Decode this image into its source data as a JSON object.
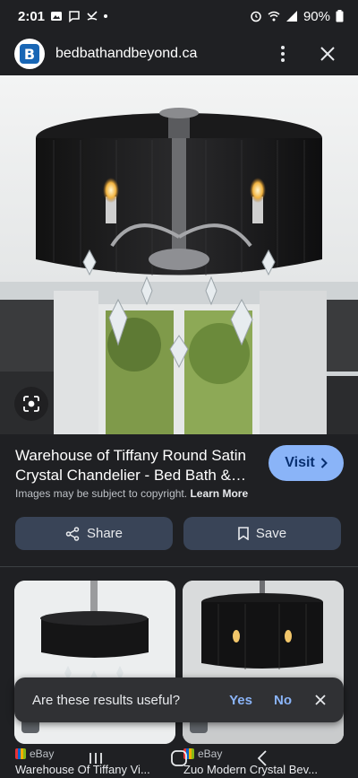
{
  "status": {
    "time": "2:01",
    "battery": "90%"
  },
  "appbar": {
    "site": "bedbathandbeyond.ca",
    "logo_letter": "B"
  },
  "result": {
    "title": "Warehouse of Tiffany Round Satin Crystal Chandelier - Bed Bath & Beyond",
    "visit_label": "Visit",
    "copyright": "Images may be subject to copyright.",
    "learn_more": "Learn More",
    "share_label": "Share",
    "save_label": "Save"
  },
  "related": [
    {
      "source": "eBay",
      "title": "Warehouse Of Tiffany Vi..."
    },
    {
      "source": "eBay",
      "title": "Zuo Modern Crystal Bev..."
    }
  ],
  "feedback": {
    "question": "Are these results useful?",
    "yes": "Yes",
    "no": "No"
  },
  "colors": {
    "accent": "#8ab4f8",
    "background": "#1f2023",
    "button": "#394457"
  }
}
